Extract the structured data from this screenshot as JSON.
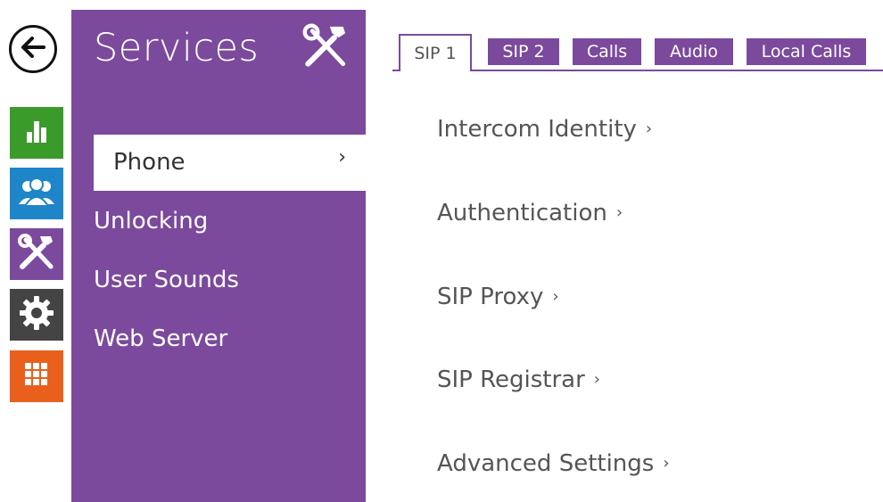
{
  "rail": {
    "back": "back-arrow-icon",
    "items": [
      {
        "icon": "status-chart-icon",
        "color": "#3a9a2a"
      },
      {
        "icon": "directory-users-icon",
        "color": "#1e86c8"
      },
      {
        "icon": "services-tools-icon",
        "color": "#7b4a9c"
      },
      {
        "icon": "system-gear-icon",
        "color": "#444444"
      },
      {
        "icon": "hardware-grid-icon",
        "color": "#e8601c"
      }
    ]
  },
  "sidebar": {
    "title": "Services",
    "title_icon": "tools-icon",
    "items": [
      {
        "label": "Phone",
        "chevron": "›",
        "active": true
      },
      {
        "label": "Unlocking"
      },
      {
        "label": "User Sounds"
      },
      {
        "label": "Web Server"
      }
    ]
  },
  "tabs": [
    {
      "label": "SIP 1",
      "active": true
    },
    {
      "label": "SIP 2"
    },
    {
      "label": "Calls"
    },
    {
      "label": "Audio"
    },
    {
      "label": "Local Calls"
    }
  ],
  "main": {
    "links": [
      {
        "label": "Intercom Identity",
        "chevron": "›"
      },
      {
        "label": "Authentication",
        "chevron": "›"
      },
      {
        "label": "SIP Proxy",
        "chevron": "›"
      },
      {
        "label": "SIP Registrar",
        "chevron": "›"
      },
      {
        "label": "Advanced Settings",
        "chevron": "›"
      }
    ]
  },
  "colors": {
    "accent": "#7b4a9c",
    "status_green": "#3a9a2a",
    "directory_blue": "#1e86c8",
    "system_dark": "#444444",
    "hardware_orange": "#e8601c"
  }
}
